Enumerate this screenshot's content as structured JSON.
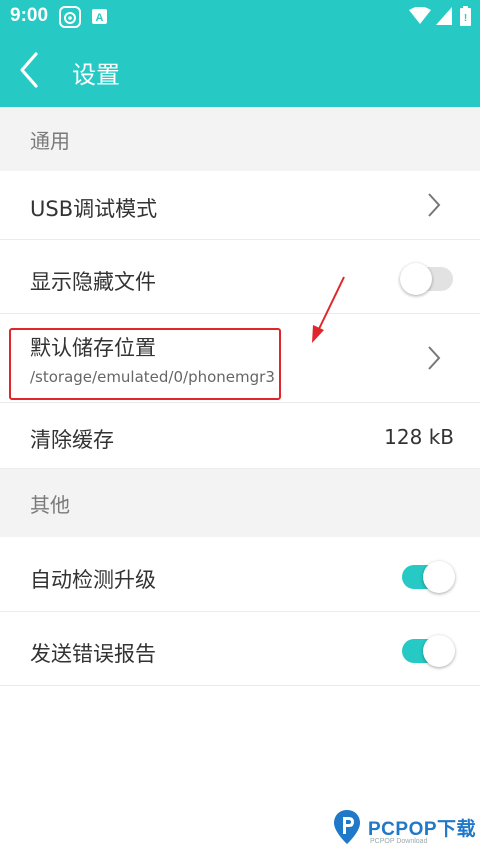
{
  "status_bar": {
    "time": "9:00",
    "app_icon_1": "camera-app-icon",
    "app_icon_2": "a-notification-icon",
    "wifi_icon": "wifi-icon",
    "signal_icon": "cell-signal-icon",
    "battery_icon": "battery-icon"
  },
  "toolbar": {
    "back_icon": "chevron-left-icon",
    "title": "设置"
  },
  "sections": {
    "general": {
      "header": "通用",
      "usb_debug": {
        "label": "USB调试模式"
      },
      "show_hidden": {
        "label": "显示隐藏文件",
        "enabled": false
      },
      "default_storage": {
        "label": "默认储存位置",
        "path": "/storage/emulated/0/phonemgr3"
      },
      "clear_cache": {
        "label": "清除缓存",
        "value": "128 kB"
      }
    },
    "other": {
      "header": "其他",
      "auto_update": {
        "label": "自动检测升级",
        "enabled": true
      },
      "send_error": {
        "label": "发送错误报告",
        "enabled": true
      }
    }
  },
  "watermark": {
    "brand": "PCPOP下载",
    "sub": "PCPOP Download"
  },
  "colors": {
    "accent": "#26c9c4",
    "highlight": "#e0262b"
  }
}
